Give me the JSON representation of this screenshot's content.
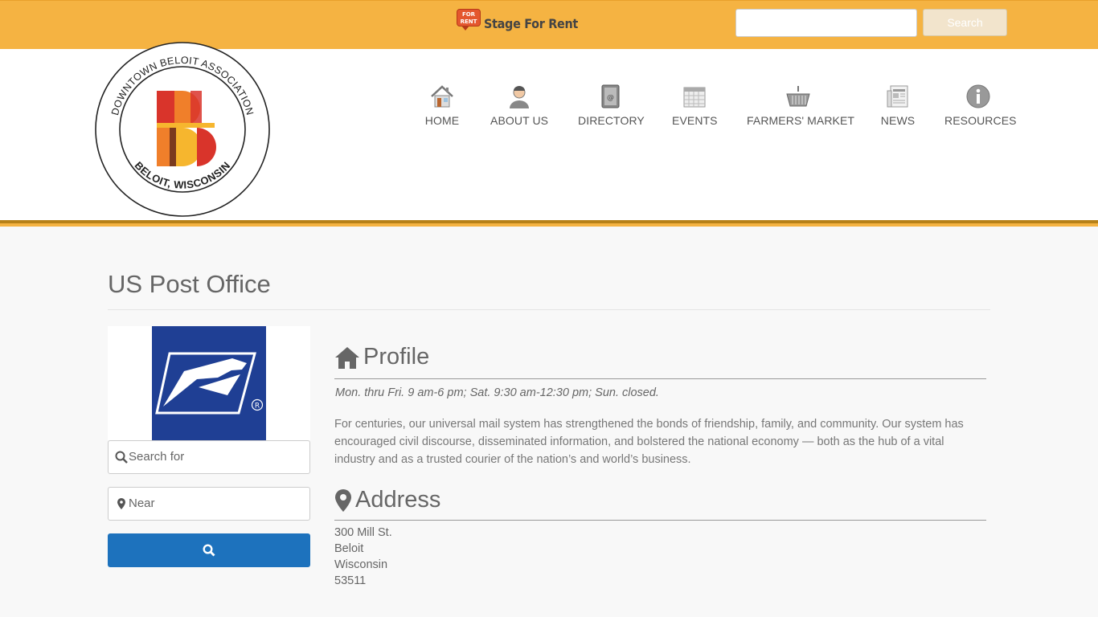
{
  "topbar": {
    "rent_badge": "FOR RENT",
    "rent_label": "Stage For Rent",
    "search_placeholder": "",
    "search_button": "Search"
  },
  "logo": {
    "ring_top": "DOWNTOWN BELOIT ASSOCIATION",
    "ring_bottom": "BELOIT, WISCONSIN",
    "brand_colors": [
      "#d9342b",
      "#f07f2a",
      "#f6b62e",
      "#d9342b"
    ]
  },
  "nav": {
    "items": [
      {
        "label": "HOME",
        "icon": "house-icon"
      },
      {
        "label": "ABOUT US",
        "icon": "person-icon"
      },
      {
        "label": "DIRECTORY",
        "icon": "address-book-icon"
      },
      {
        "label": "EVENTS",
        "icon": "calendar-icon"
      },
      {
        "label": "FARMERS' MARKET",
        "icon": "basket-icon"
      },
      {
        "label": "NEWS",
        "icon": "newspaper-icon"
      },
      {
        "label": "RESOURCES",
        "icon": "info-icon"
      }
    ]
  },
  "page": {
    "title": "US Post Office"
  },
  "sidebar": {
    "search_for": "Search for",
    "near": "Near"
  },
  "profile": {
    "heading": "Profile",
    "hours": "Mon. thru Fri. 9 am-6 pm; Sat. 9:30 am-12:30 pm; Sun. closed.",
    "description": "For centuries, our universal mail system has strengthened the bonds of friendship, family, and community. Our system has encouraged civil discourse, disseminated information, and bolstered the national economy — both as the hub of a vital industry and as a trusted courier of the nation’s and world’s business."
  },
  "address": {
    "heading": "Address",
    "street": "300 Mill St.",
    "city": "Beloit",
    "state": "Wisconsin",
    "zip": "53511"
  },
  "colors": {
    "topbar": "#f5b342",
    "accent_dark": "#b78118",
    "button_blue": "#1d72bd",
    "usps_blue": "#1f3f94"
  }
}
